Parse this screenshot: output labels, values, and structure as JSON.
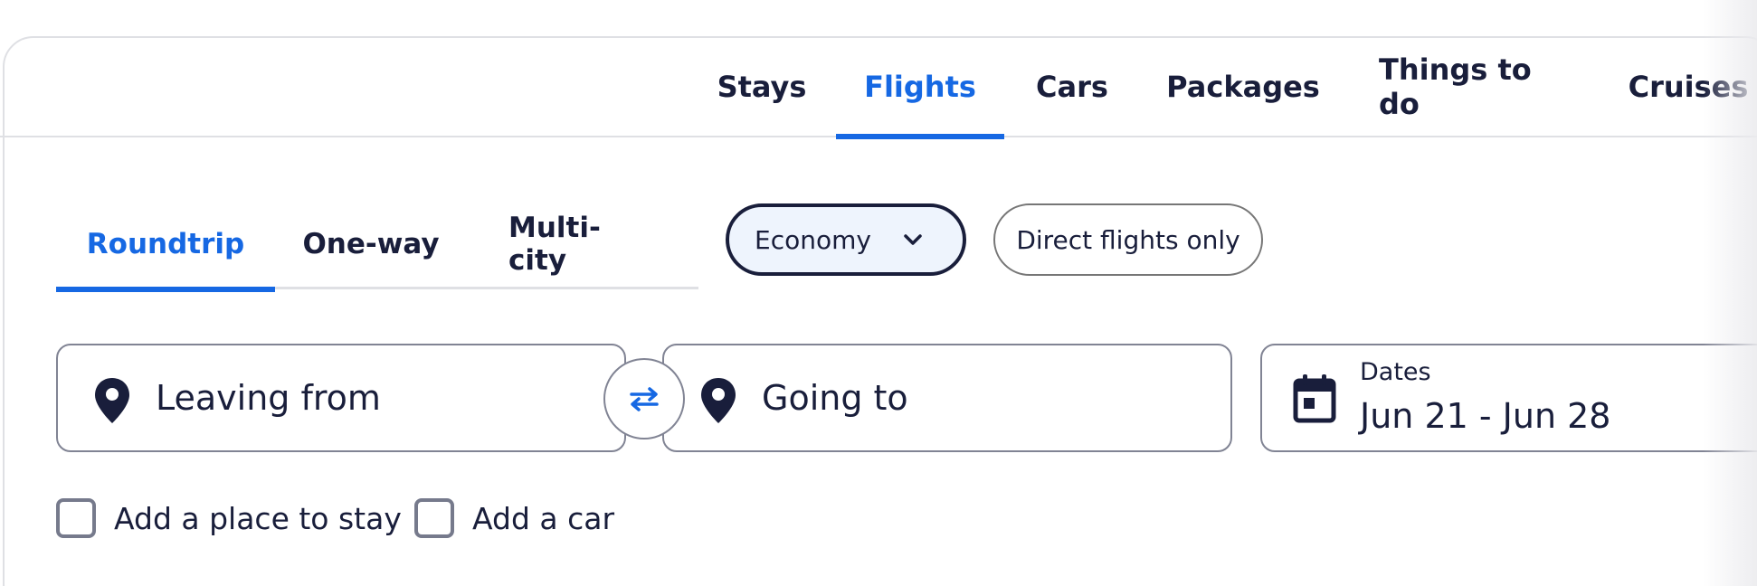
{
  "nav": {
    "tabs": [
      {
        "label": "Stays",
        "active": false
      },
      {
        "label": "Flights",
        "active": true
      },
      {
        "label": "Cars",
        "active": false
      },
      {
        "label": "Packages",
        "active": false
      },
      {
        "label": "Things to do",
        "active": false
      },
      {
        "label": "Cruises",
        "active": false
      }
    ]
  },
  "trip_type": {
    "tabs": [
      {
        "label": "Roundtrip",
        "active": true
      },
      {
        "label": "One-way",
        "active": false
      },
      {
        "label": "Multi-city",
        "active": false
      }
    ]
  },
  "cabin_class": {
    "selected": "Economy",
    "icon": "chevron-down-icon"
  },
  "direct_flights": {
    "label": "Direct flights only"
  },
  "search": {
    "origin": {
      "placeholder": "Leaving from",
      "icon": "location-pin-icon"
    },
    "destination": {
      "placeholder": "Going to",
      "icon": "location-pin-icon"
    },
    "swap_icon": "swap-arrows-icon",
    "dates": {
      "label": "Dates",
      "value": "Jun 21 - Jun 28",
      "icon": "calendar-icon"
    }
  },
  "addons": [
    {
      "label": "Add a place to stay",
      "checked": false
    },
    {
      "label": "Add a car",
      "checked": false
    }
  ],
  "colors": {
    "accent": "#1668e3",
    "text": "#191e3b",
    "border": "#818494",
    "pill_selected_bg": "#eef4fd"
  }
}
